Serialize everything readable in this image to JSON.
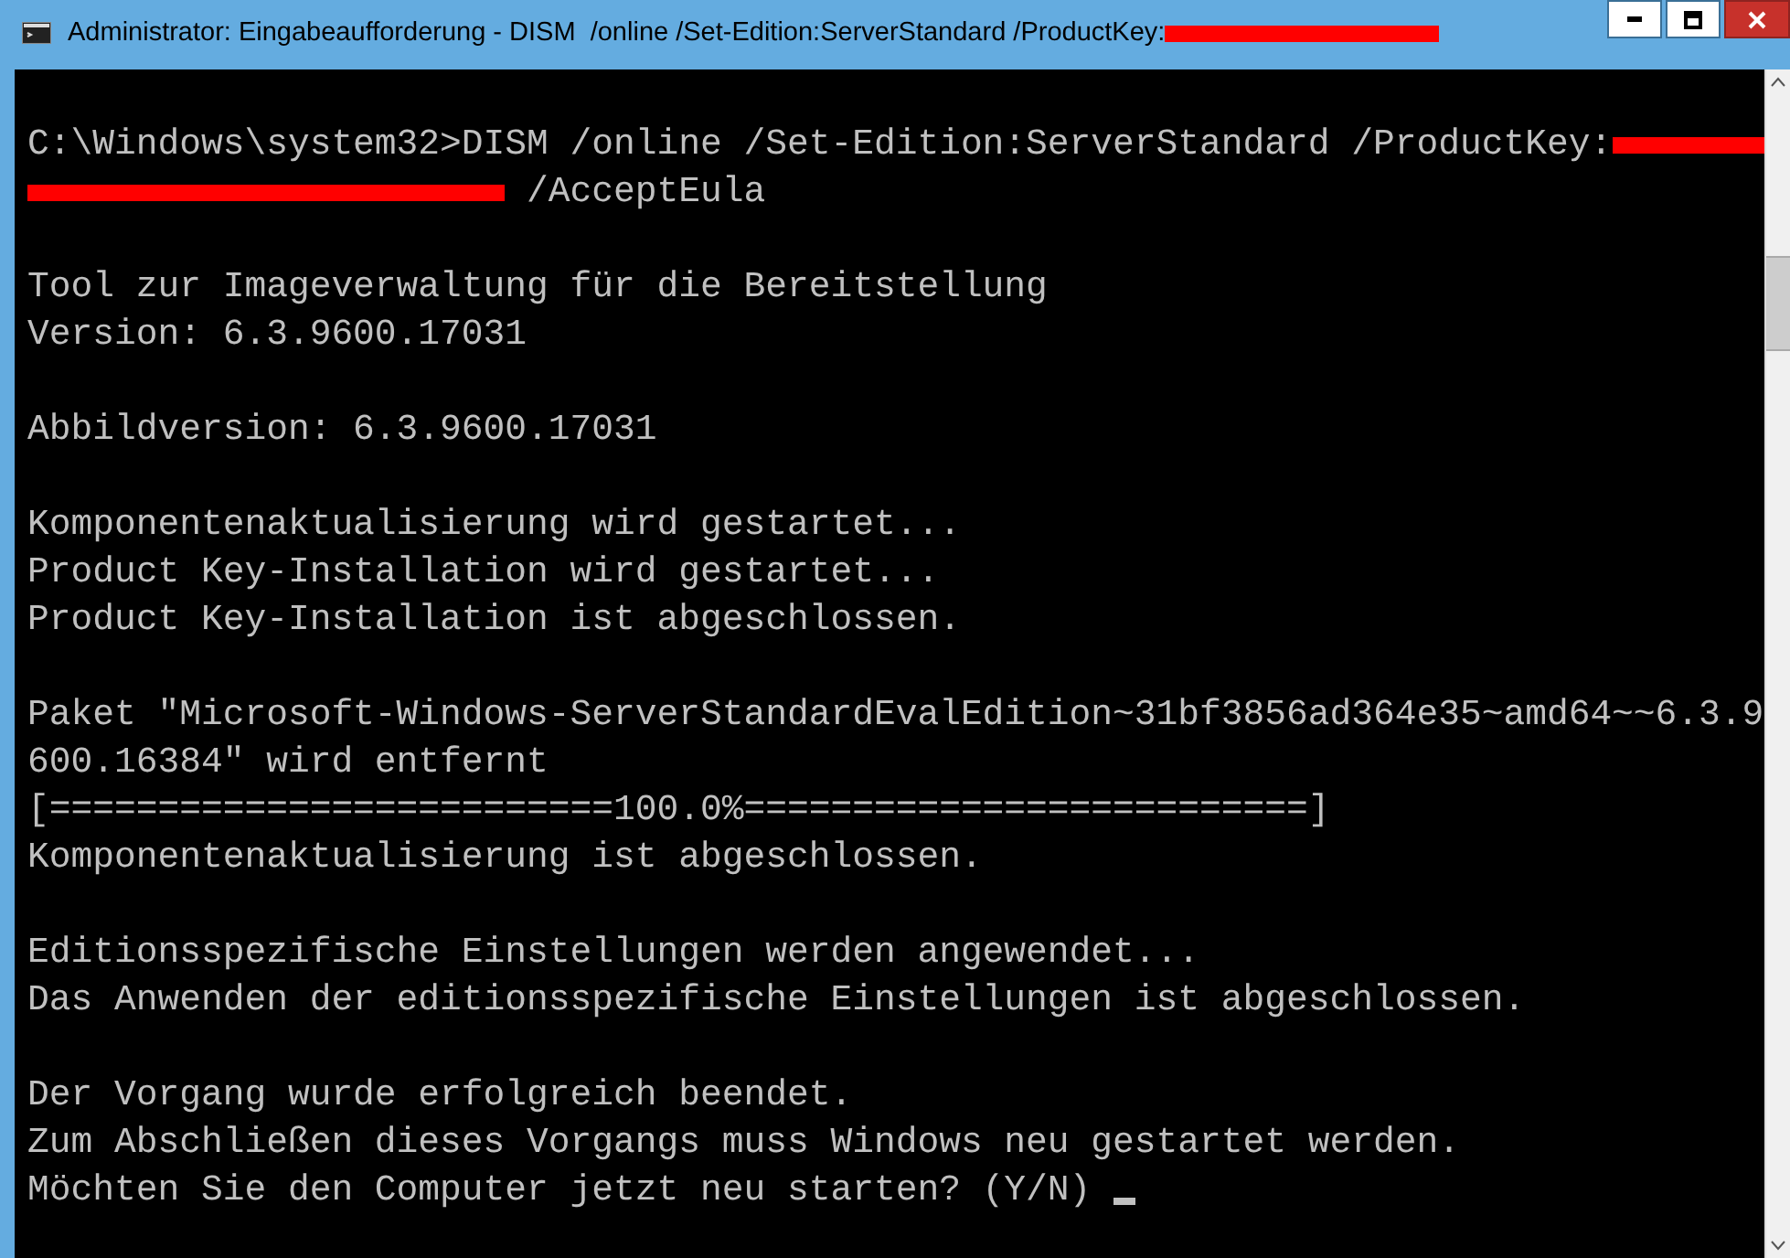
{
  "window": {
    "title": "Administrator: Eingabeaufforderung - DISM  /online /Set-Edition:ServerStandard /ProductKey:",
    "title_redacted": true
  },
  "console": {
    "cursor_visible": true,
    "lines": [
      {
        "kind": "blank"
      },
      {
        "kind": "redacted-end",
        "text": "C:\\Windows\\system32>DISM /online /Set-Edition:ServerStandard /ProductKey:"
      },
      {
        "kind": "redacted-start",
        "text": " /AcceptEula"
      },
      {
        "kind": "blank"
      },
      {
        "kind": "text",
        "text": "Tool zur Imageverwaltung für die Bereitstellung"
      },
      {
        "kind": "text",
        "text": "Version: 6.3.9600.17031"
      },
      {
        "kind": "blank"
      },
      {
        "kind": "text",
        "text": "Abbildversion: 6.3.9600.17031"
      },
      {
        "kind": "blank"
      },
      {
        "kind": "text",
        "text": "Komponentenaktualisierung wird gestartet..."
      },
      {
        "kind": "text",
        "text": "Product Key-Installation wird gestartet..."
      },
      {
        "kind": "text",
        "text": "Product Key-Installation ist abgeschlossen."
      },
      {
        "kind": "blank"
      },
      {
        "kind": "text",
        "text": "Paket \"Microsoft-Windows-ServerStandardEvalEdition~31bf3856ad364e35~amd64~~6.3.9"
      },
      {
        "kind": "text",
        "text": "600.16384\" wird entfernt"
      },
      {
        "kind": "text",
        "text": "[==========================100.0%==========================]"
      },
      {
        "kind": "text",
        "text": "Komponentenaktualisierung ist abgeschlossen."
      },
      {
        "kind": "blank"
      },
      {
        "kind": "text",
        "text": "Editionsspezifische Einstellungen werden angewendet..."
      },
      {
        "kind": "text",
        "text": "Das Anwenden der editionsspezifische Einstellungen ist abgeschlossen."
      },
      {
        "kind": "blank"
      },
      {
        "kind": "text",
        "text": "Der Vorgang wurde erfolgreich beendet."
      },
      {
        "kind": "text",
        "text": "Zum Abschließen dieses Vorgangs muss Windows neu gestartet werden."
      },
      {
        "kind": "prompt",
        "text": "Möchten Sie den Computer jetzt neu starten? (Y/N) "
      }
    ]
  }
}
